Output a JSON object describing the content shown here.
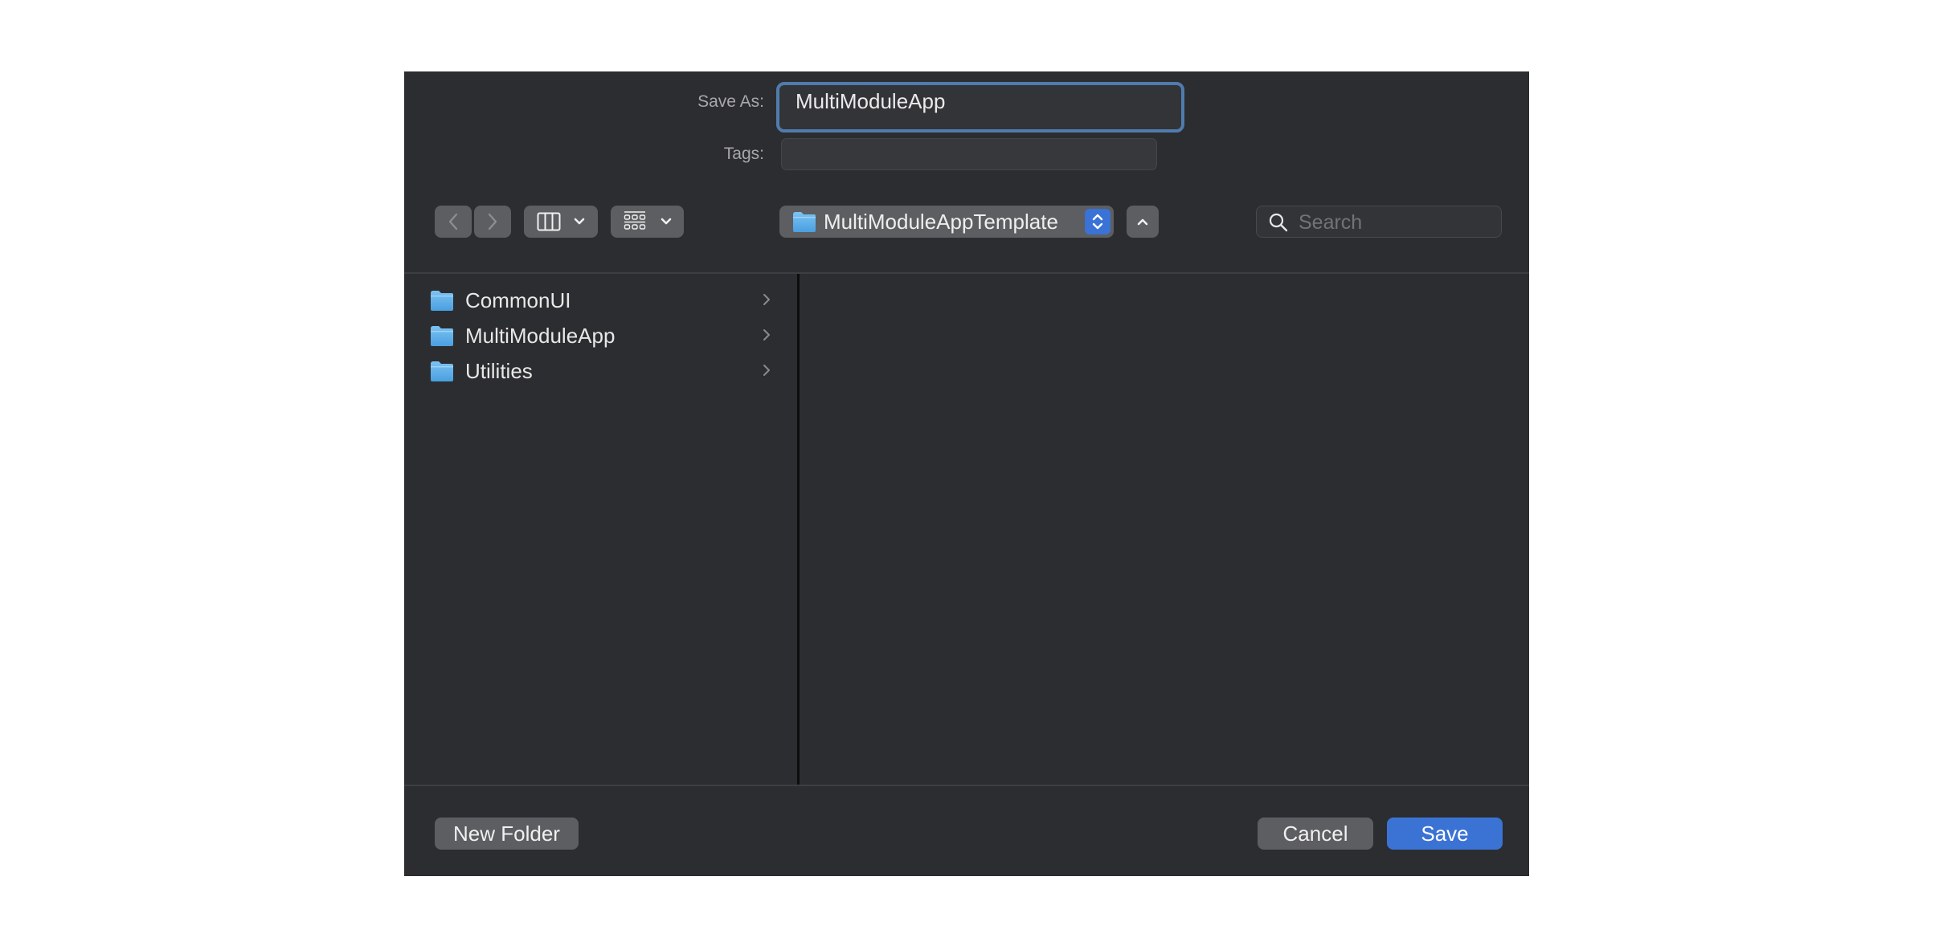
{
  "dialog": {
    "save_as_label": "Save As:",
    "save_as_value": "MultiModuleApp",
    "tags_label": "Tags:",
    "tags_value": ""
  },
  "toolbar": {
    "back_icon": "chevron-left-icon",
    "forward_icon": "chevron-right-icon",
    "view_icon": "column-view-icon",
    "group_icon": "group-grid-icon",
    "location": "MultiModuleAppTemplate",
    "up_icon": "chevron-up-icon",
    "search_placeholder": "Search"
  },
  "browser": {
    "column1": [
      {
        "name": "CommonUI",
        "icon": "folder-icon"
      },
      {
        "name": "MultiModuleApp",
        "icon": "folder-icon"
      },
      {
        "name": "Utilities",
        "icon": "folder-icon"
      }
    ]
  },
  "footer": {
    "new_folder_label": "New Folder",
    "cancel_label": "Cancel",
    "save_label": "Save"
  },
  "colors": {
    "background": "#2c2d30",
    "accent": "#3b73d5",
    "focus_ring": "#4f7cad",
    "button": "#5d5e61"
  }
}
